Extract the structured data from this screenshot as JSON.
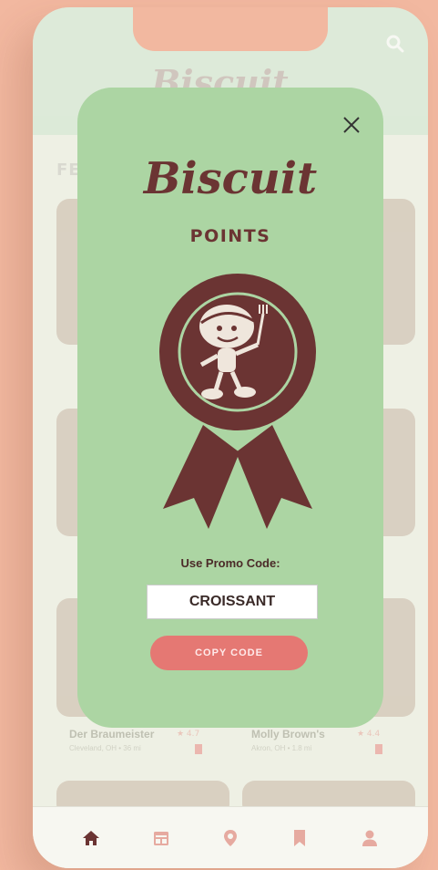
{
  "app": {
    "logo_text": "Biscuit",
    "section_title": "FE"
  },
  "cards": [
    {
      "name": "Der Braumeister",
      "meta": "Cleveland, OH • 36 mi",
      "rating": "★ 4.7"
    },
    {
      "name": "Molly Brown's",
      "meta": "Akron, OH • 1.8 mi",
      "rating": "★ 4.4"
    }
  ],
  "modal": {
    "title": "Biscuit",
    "subtitle": "POINTS",
    "promo_label": "Use Promo Code:",
    "promo_code": "CROISSANT",
    "copy_button": "COPY CODE"
  },
  "tabs": [
    {
      "icon": "home-icon",
      "active": true
    },
    {
      "icon": "calendar-icon",
      "active": false
    },
    {
      "icon": "location-pin-icon",
      "active": false
    },
    {
      "icon": "bookmark-icon",
      "active": false
    },
    {
      "icon": "profile-icon",
      "active": false
    }
  ],
  "colors": {
    "page_background": "#f2b8a0",
    "modal_green": "#acd5a3",
    "brand_brown": "#6b3433",
    "accent_coral": "#e57873"
  }
}
